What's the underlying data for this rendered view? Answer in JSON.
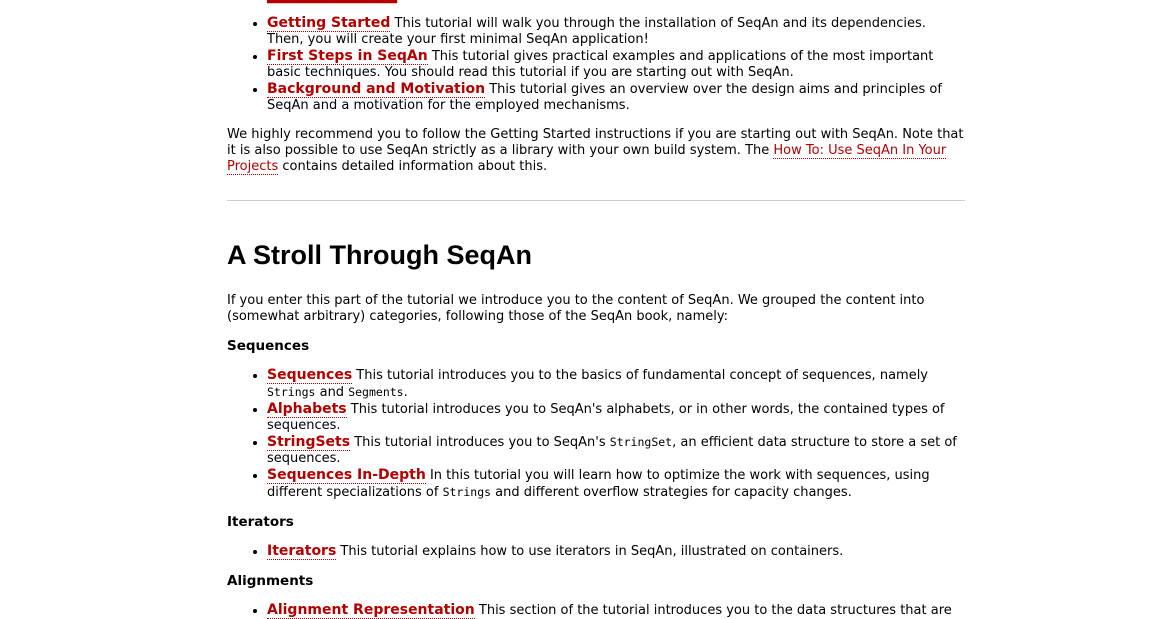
{
  "intro_list": [
    {
      "title": "Getting Started",
      "desc": " This tutorial will walk you through the installation of SeqAn and its dependencies. Then, you will create your first minimal SeqAn application!"
    },
    {
      "title": "First Steps in SeqAn",
      "desc": " This tutorial gives practical examples and applications of the most important basic techniques. You should read this tutorial if you are starting out with SeqAn."
    },
    {
      "title": "Background and Motivation",
      "desc": " This tutorial gives an overview over the design aims and principles of SeqAn and a motivation for the employed mechanisms."
    }
  ],
  "recommend": {
    "text_before": "We highly recommend you to follow the Getting Started instructions if you are starting out with SeqAn. Note that it is also possible to use SeqAn strictly as a library with your own build system. The ",
    "link": "How To: Use SeqAn In Your Projects",
    "text_after": " contains detailed information about this."
  },
  "stroll": {
    "heading": "A Stroll Through SeqAn",
    "intro": "If you enter this part of the tutorial we introduce you to the content of SeqAn. We grouped the content into (somewhat arbitrary) categories, following those of the SeqAn book, namely:"
  },
  "sequences": {
    "heading": "Sequences",
    "items": [
      {
        "title": "Sequences",
        "t1": " This tutorial introduces you to the basics of fundamental concept of sequences, namely ",
        "c1": "Strings",
        "t2": " and ",
        "c2": "Segments",
        "t3": "."
      },
      {
        "title": "Alphabets",
        "desc": " This tutorial introduces you to SeqAn's alphabets, or in other words, the contained types of sequences."
      },
      {
        "title": "StringSets",
        "t1": " This tutorial introduces you to SeqAn's ",
        "c1": "StringSet",
        "t2": ", an efficient data structure to store a set of sequences."
      },
      {
        "title": "Sequences In-Depth",
        "t1": " In this tutorial you will learn how to optimize the work with sequences, using different specializations of ",
        "c1": "Strings",
        "t2": " and different overflow strategies for capacity changes."
      }
    ]
  },
  "iterators": {
    "heading": "Iterators",
    "items": [
      {
        "title": "Iterators",
        "desc": " This tutorial explains how to use iterators in SeqAn, illustrated on containers."
      }
    ]
  },
  "alignments": {
    "heading": "Alignments",
    "items": [
      {
        "title": "Alignment Representation",
        "desc": " This section of the tutorial introduces you to the data structures that are"
      }
    ]
  },
  "colors": {
    "link": "#b50000",
    "rule": "#cccccc",
    "text": "#000000"
  }
}
